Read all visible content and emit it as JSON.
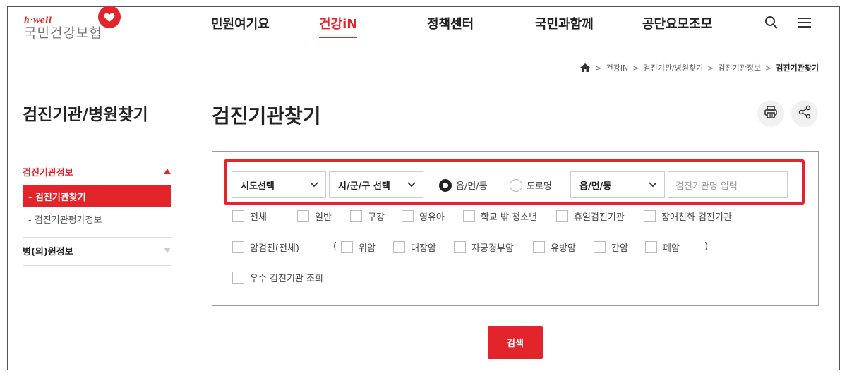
{
  "logo": {
    "small": "h·well",
    "main": "국민건강보험"
  },
  "gnb": [
    {
      "label": "민원여기요"
    },
    {
      "label": "건강iN",
      "active": true
    },
    {
      "label": "정책센터"
    },
    {
      "label": "국민과함께"
    },
    {
      "label": "공단요모조모"
    }
  ],
  "header_icons": [
    "search-icon",
    "menu-icon"
  ],
  "breadcrumb": [
    "건강iN",
    "검진기관/병원찾기",
    "검진기관정보",
    "검진기관찾기"
  ],
  "sidebar": {
    "title": "검진기관/병원찾기",
    "sections": [
      {
        "label": "검진기관정보",
        "expanded": true,
        "items": [
          {
            "label": "- 검진기관찾기",
            "active": true
          },
          {
            "label": "- 검진기관평가정보"
          }
        ]
      },
      {
        "label": "병(의)원정보",
        "expanded": false
      }
    ]
  },
  "main": {
    "title": "검진기관찾기",
    "actions": [
      "print-icon",
      "share-icon"
    ]
  },
  "search": {
    "sido": "시도선택",
    "sigungu": "시/군/구 선택",
    "radio": [
      {
        "label": "읍/면/동",
        "checked": true
      },
      {
        "label": "도로명",
        "checked": false
      }
    ],
    "dong": "읍/면/동",
    "name_placeholder": "검진기관명 입력",
    "row1": [
      "전체",
      "일반",
      "구강",
      "영유아",
      "학교 밖 청소년",
      "휴일검진기관",
      "장애친화 검진기관"
    ],
    "row2_lead": "암검진(전체)",
    "row2_open": "(",
    "row2": [
      "위암",
      "대장암",
      "자궁경부암",
      "유방암",
      "간암",
      "폐암"
    ],
    "row2_close": ")",
    "row3": [
      "우수 검진기관 조회"
    ],
    "button": "검색"
  },
  "colors": {
    "accent": "#e3242b",
    "text": "#222222",
    "border": "#999999"
  }
}
